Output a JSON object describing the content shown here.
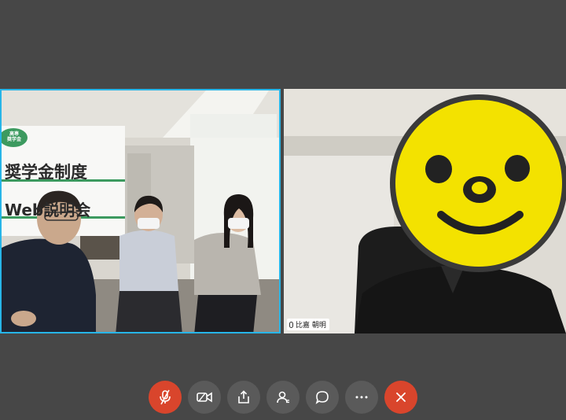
{
  "participants": [
    {
      "id": "left",
      "banner": {
        "logo_line1": "高専",
        "logo_line2": "奨学金",
        "line1": "奨学金制度",
        "line2": "Web説明会"
      },
      "active": true
    },
    {
      "id": "right",
      "name": "比嘉 朝明",
      "active": false
    }
  ],
  "toolbar": {
    "buttons": [
      {
        "id": "mic",
        "icon": "mic-muted-icon",
        "state": "muted"
      },
      {
        "id": "video",
        "icon": "video-camera-icon"
      },
      {
        "id": "share",
        "icon": "share-screen-icon"
      },
      {
        "id": "participants",
        "icon": "participants-icon"
      },
      {
        "id": "chat",
        "icon": "chat-bubble-icon"
      },
      {
        "id": "more",
        "icon": "more-dots-icon"
      },
      {
        "id": "leave",
        "icon": "close-icon"
      }
    ],
    "colors": {
      "danger": "#d9452c",
      "neutral": "#5a5a5a",
      "active_border": "#27b5e8"
    }
  }
}
